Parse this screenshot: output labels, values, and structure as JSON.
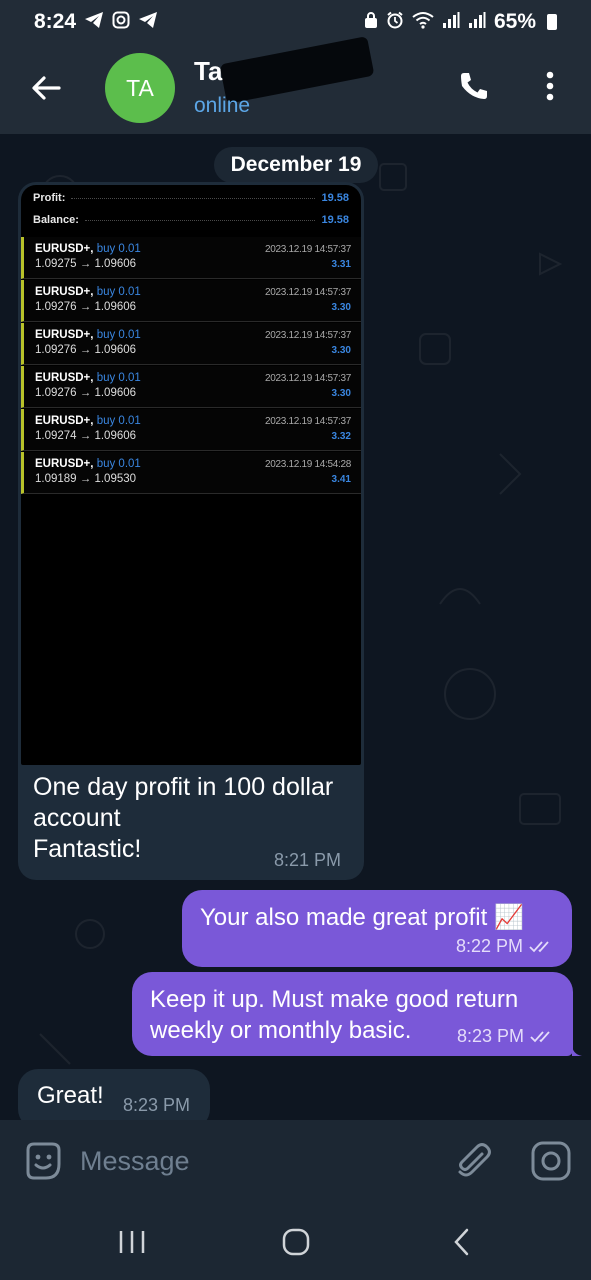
{
  "status_bar": {
    "time": "8:24",
    "battery": "65%",
    "left_icons": [
      "telegram-icon",
      "instagram-icon",
      "telegram-icon"
    ],
    "right_icons": [
      "lock-icon",
      "alarm-icon",
      "wifi-icon",
      "signal-icon",
      "signal-icon",
      "battery-icon"
    ]
  },
  "header": {
    "avatar_initials": "TA",
    "avatar_color": "#5cbe4c",
    "contact_name": "Tar",
    "status": "online"
  },
  "chat": {
    "date_label": "December 19",
    "photo_message": {
      "summary": [
        {
          "label": "Profit:",
          "value": "19.58"
        },
        {
          "label": "Balance:",
          "value": "19.58"
        }
      ],
      "trades": [
        {
          "symbol": "EURUSD+,",
          "side": "buy 0.01",
          "prices": "1.09275 → 1.09606",
          "time": "2023.12.19 14:57:37",
          "profit": "3.31"
        },
        {
          "symbol": "EURUSD+,",
          "side": "buy 0.01",
          "prices": "1.09276 → 1.09606",
          "time": "2023.12.19 14:57:37",
          "profit": "3.30"
        },
        {
          "symbol": "EURUSD+,",
          "side": "buy 0.01",
          "prices": "1.09276 → 1.09606",
          "time": "2023.12.19 14:57:37",
          "profit": "3.30"
        },
        {
          "symbol": "EURUSD+,",
          "side": "buy 0.01",
          "prices": "1.09276 → 1.09606",
          "time": "2023.12.19 14:57:37",
          "profit": "3.30"
        },
        {
          "symbol": "EURUSD+,",
          "side": "buy 0.01",
          "prices": "1.09274 → 1.09606",
          "time": "2023.12.19 14:57:37",
          "profit": "3.32"
        },
        {
          "symbol": "EURUSD+,",
          "side": "buy 0.01",
          "prices": "1.09189 → 1.09530",
          "time": "2023.12.19 14:54:28",
          "profit": "3.41"
        }
      ],
      "caption_lines": [
        "One day profit in 100 dollar",
        "account",
        "Fantastic!"
      ],
      "time": "8:21 PM"
    },
    "outgoing": [
      {
        "text_lines": [
          "Your also made great profit 📈"
        ],
        "time": "8:22 PM"
      },
      {
        "text_lines": [
          "Keep it up. Must make good return",
          "weekly or monthly basic."
        ],
        "time": "8:23 PM"
      }
    ],
    "last_incoming": {
      "text": "Great!",
      "time": "8:23 PM"
    }
  },
  "input_bar": {
    "placeholder": "Message"
  },
  "colors": {
    "outgoing_bubble": "#7a58d8",
    "incoming_bubble": "#1e2c3a",
    "accent_blue": "#5ca6e6"
  }
}
